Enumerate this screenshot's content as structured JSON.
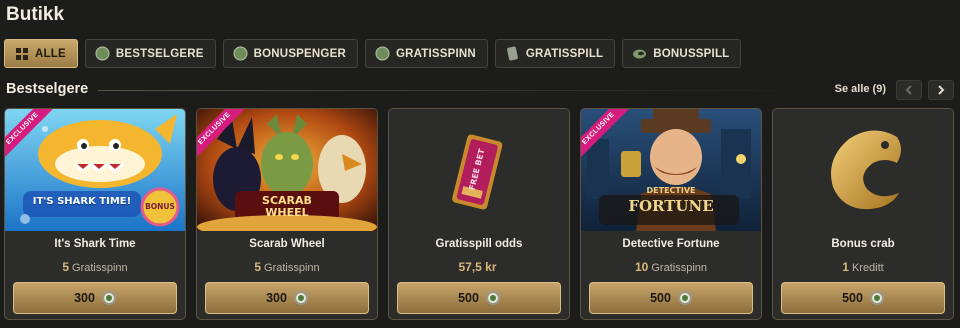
{
  "page": {
    "title": "Butikk"
  },
  "filters": [
    {
      "label": "ALLE",
      "icon": "grid-icon",
      "active": true
    },
    {
      "label": "BESTSELGERE",
      "icon": "coin-icon",
      "active": false
    },
    {
      "label": "BONUSPENGER",
      "icon": "coin-icon",
      "active": false
    },
    {
      "label": "GRATISSPINN",
      "icon": "coin-icon",
      "active": false
    },
    {
      "label": "GRATISSPILL",
      "icon": "ticket-icon",
      "active": false
    },
    {
      "label": "BONUSSPILL",
      "icon": "crab-icon",
      "active": false
    }
  ],
  "section": {
    "title": "Bestselgere",
    "see_all": "Se alle (9)"
  },
  "cards": [
    {
      "name": "It's Shark Time",
      "amount": "5",
      "unit": "Gratisspinn",
      "price": "300",
      "exclusive": "EXCLUSIVE",
      "art_text": "IT'S SHARK TIME!",
      "art_badge": "BONUS"
    },
    {
      "name": "Scarab Wheel",
      "amount": "5",
      "unit": "Gratisspinn",
      "price": "300",
      "exclusive": "EXCLUSIVE",
      "art_text": "SCARAB WHEEL"
    },
    {
      "name": "Gratisspill odds",
      "amount": "57,5 kr",
      "unit": "",
      "price": "500",
      "art_text": "FREE BET"
    },
    {
      "name": "Detective Fortune",
      "amount": "10",
      "unit": "Gratisspinn",
      "price": "500",
      "exclusive": "EXCLUSIVE",
      "art_text": "DETECTIVE",
      "art_text2": "FORTUNE"
    },
    {
      "name": "Bonus crab",
      "amount": "1",
      "unit": "Kreditt",
      "price": "500"
    }
  ],
  "colors": {
    "gold": "#c7a46a",
    "background": "#1c1d1b",
    "card": "#2c2c2a",
    "exclusive": "#d61d7e"
  }
}
